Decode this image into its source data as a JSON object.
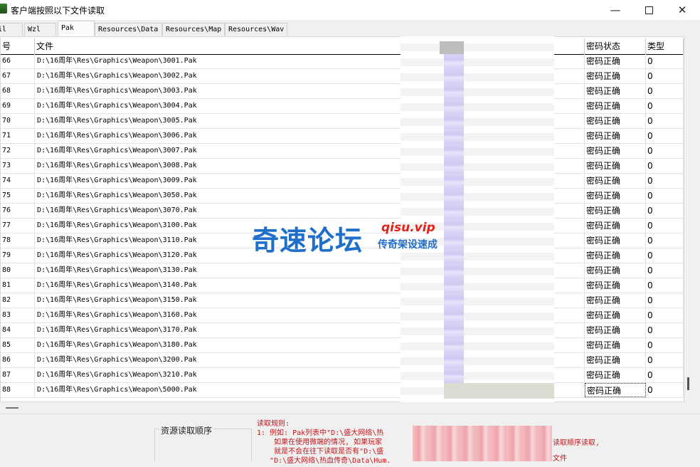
{
  "window": {
    "title": "客户端按照以下文件读取",
    "min_glyph": "—",
    "close_glyph": "✕"
  },
  "tabs": [
    {
      "label": "il"
    },
    {
      "label": "Wzl"
    },
    {
      "label": "Pak",
      "active": true
    },
    {
      "label": "Resources\\Data"
    },
    {
      "label": "Resources\\Map"
    },
    {
      "label": "Resources\\Wav"
    }
  ],
  "table": {
    "headers": {
      "index": "号",
      "file": "文件",
      "password_status": "密码状态",
      "type": "类型"
    },
    "rows": [
      {
        "index": "66",
        "file": "D:\\16周年\\Res\\Graphics\\Weapon\\3001.Pak",
        "status": "密码正确",
        "type": "0"
      },
      {
        "index": "67",
        "file": "D:\\16周年\\Res\\Graphics\\Weapon\\3002.Pak",
        "status": "密码正确",
        "type": "0"
      },
      {
        "index": "68",
        "file": "D:\\16周年\\Res\\Graphics\\Weapon\\3003.Pak",
        "status": "密码正确",
        "type": "0"
      },
      {
        "index": "69",
        "file": "D:\\16周年\\Res\\Graphics\\Weapon\\3004.Pak",
        "status": "密码正确",
        "type": "0"
      },
      {
        "index": "70",
        "file": "D:\\16周年\\Res\\Graphics\\Weapon\\3005.Pak",
        "status": "密码正确",
        "type": "0"
      },
      {
        "index": "71",
        "file": "D:\\16周年\\Res\\Graphics\\Weapon\\3006.Pak",
        "status": "密码正确",
        "type": "0"
      },
      {
        "index": "72",
        "file": "D:\\16周年\\Res\\Graphics\\Weapon\\3007.Pak",
        "status": "密码正确",
        "type": "0"
      },
      {
        "index": "73",
        "file": "D:\\16周年\\Res\\Graphics\\Weapon\\3008.Pak",
        "status": "密码正确",
        "type": "0"
      },
      {
        "index": "74",
        "file": "D:\\16周年\\Res\\Graphics\\Weapon\\3009.Pak",
        "status": "密码正确",
        "type": "0"
      },
      {
        "index": "75",
        "file": "D:\\16周年\\Res\\Graphics\\Weapon\\3050.Pak",
        "status": "密码正确",
        "type": "0"
      },
      {
        "index": "76",
        "file": "D:\\16周年\\Res\\Graphics\\Weapon\\3070.Pak",
        "status": "密码正确",
        "type": "0"
      },
      {
        "index": "77",
        "file": "D:\\16周年\\Res\\Graphics\\Weapon\\3100.Pak",
        "status": "密码正确",
        "type": "0"
      },
      {
        "index": "78",
        "file": "D:\\16周年\\Res\\Graphics\\Weapon\\3110.Pak",
        "status": "密码正确",
        "type": "0"
      },
      {
        "index": "79",
        "file": "D:\\16周年\\Res\\Graphics\\Weapon\\3120.Pak",
        "status": "密码正确",
        "type": "0"
      },
      {
        "index": "80",
        "file": "D:\\16周年\\Res\\Graphics\\Weapon\\3130.Pak",
        "status": "密码正确",
        "type": "0"
      },
      {
        "index": "81",
        "file": "D:\\16周年\\Res\\Graphics\\Weapon\\3140.Pak",
        "status": "密码正确",
        "type": "0"
      },
      {
        "index": "82",
        "file": "D:\\16周年\\Res\\Graphics\\Weapon\\3150.Pak",
        "status": "密码正确",
        "type": "0"
      },
      {
        "index": "83",
        "file": "D:\\16周年\\Res\\Graphics\\Weapon\\3160.Pak",
        "status": "密码正确",
        "type": "0"
      },
      {
        "index": "84",
        "file": "D:\\16周年\\Res\\Graphics\\Weapon\\3170.Pak",
        "status": "密码正确",
        "type": "0"
      },
      {
        "index": "85",
        "file": "D:\\16周年\\Res\\Graphics\\Weapon\\3180.Pak",
        "status": "密码正确",
        "type": "0"
      },
      {
        "index": "86",
        "file": "D:\\16周年\\Res\\Graphics\\Weapon\\3200.Pak",
        "status": "密码正确",
        "type": "0"
      },
      {
        "index": "87",
        "file": "D:\\16周年\\Res\\Graphics\\Weapon\\3210.Pak",
        "status": "密码正确",
        "type": "0"
      },
      {
        "index": "88",
        "file": "D:\\16周年\\Res\\Graphics\\Weapon\\5000.Pak",
        "status": "密码正确",
        "type": "0"
      }
    ]
  },
  "watermark": {
    "main": "奇速论坛",
    "url": "qisu.vip",
    "sub": "传奇架设速成"
  },
  "bottom": {
    "order_label": "资源读取顺序",
    "rules_text": "读取规则:\n1: 例如: Pak列表中\"D:\\盛大网络\\热\n    如果在使用微端的情况, 如果玩家\n    就是不会在往下读取是否有\"D:\\盛\n   \"D:\\盛大网络\\热血传奇\\Data\\Hum.",
    "rules_right_text": "读取顺序读取,\n文件"
  },
  "colors": {
    "accent_red": "#c0161b",
    "watermark_blue": "#1f6ec9"
  }
}
